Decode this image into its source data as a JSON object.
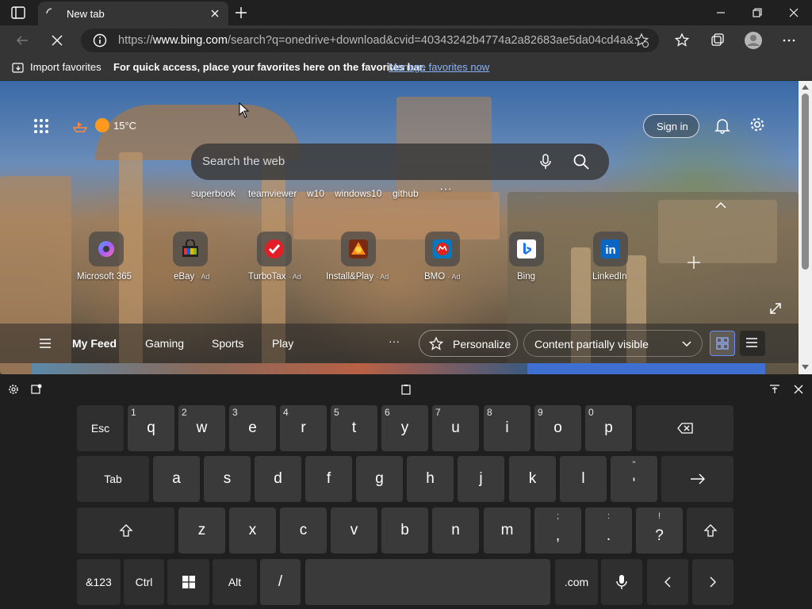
{
  "browser": {
    "tab_title": "New tab",
    "url_prefix": "https://",
    "url_host": "www.bing.com",
    "url_rest": "/search?q=onedrive+download&cvid=40343242b4774a2a82683ae5da04cd4a&...",
    "favbar": {
      "import": "Import favorites",
      "hint": "For quick access, place your favorites here on the favorites bar.",
      "manage_link": "Manage favorites now"
    }
  },
  "page": {
    "weather_temp": "15°C",
    "sign_in": "Sign in",
    "search_placeholder": "Search the web",
    "quick_searches": [
      "superbook",
      "teamviewer",
      "w10",
      "windows10",
      "github"
    ],
    "tiles": [
      {
        "label": "Microsoft 365",
        "ad": ""
      },
      {
        "label": "eBay",
        "ad": "· Ad"
      },
      {
        "label": "TurboTax",
        "ad": "· Ad"
      },
      {
        "label": "Install&Play",
        "ad": "· Ad"
      },
      {
        "label": "BMO",
        "ad": "· Ad"
      },
      {
        "label": "Bing",
        "ad": ""
      },
      {
        "label": "LinkedIn",
        "ad": ""
      }
    ],
    "feed": {
      "items": [
        "My Feed",
        "Gaming",
        "Sports",
        "Play"
      ],
      "more": "···",
      "personalize": "Personalize",
      "content_status": "Content partially visible"
    }
  },
  "keyboard": {
    "row1": [
      {
        "label": "Esc"
      },
      {
        "label": "q",
        "num": "1"
      },
      {
        "label": "w",
        "num": "2"
      },
      {
        "label": "e",
        "num": "3"
      },
      {
        "label": "r",
        "num": "4"
      },
      {
        "label": "t",
        "num": "5"
      },
      {
        "label": "y",
        "num": "6"
      },
      {
        "label": "u",
        "num": "7"
      },
      {
        "label": "i",
        "num": "8"
      },
      {
        "label": "o",
        "num": "9"
      },
      {
        "label": "p",
        "num": "0"
      }
    ],
    "row2": [
      {
        "label": "Tab"
      },
      {
        "label": "a"
      },
      {
        "label": "s"
      },
      {
        "label": "d"
      },
      {
        "label": "f"
      },
      {
        "label": "g"
      },
      {
        "label": "h"
      },
      {
        "label": "j"
      },
      {
        "label": "k"
      },
      {
        "label": "l"
      },
      {
        "label": "'",
        "alt": "\""
      }
    ],
    "row3": [
      {
        "label": "z"
      },
      {
        "label": "x"
      },
      {
        "label": "c"
      },
      {
        "label": "v"
      },
      {
        "label": "b"
      },
      {
        "label": "n"
      },
      {
        "label": "m"
      },
      {
        "label": ",",
        "alt": ";"
      },
      {
        "label": ".",
        "alt": ":"
      },
      {
        "label": "?",
        "alt": "!"
      }
    ],
    "row4": {
      "symbols": "&123",
      "ctrl": "Ctrl",
      "alt": "Alt",
      "slash": "/",
      "dotcom": ".com"
    }
  },
  "colors": {
    "accent_link": "#8ab4f8",
    "tab_bg": "#353535",
    "key_bg": "#3a3a3a"
  }
}
